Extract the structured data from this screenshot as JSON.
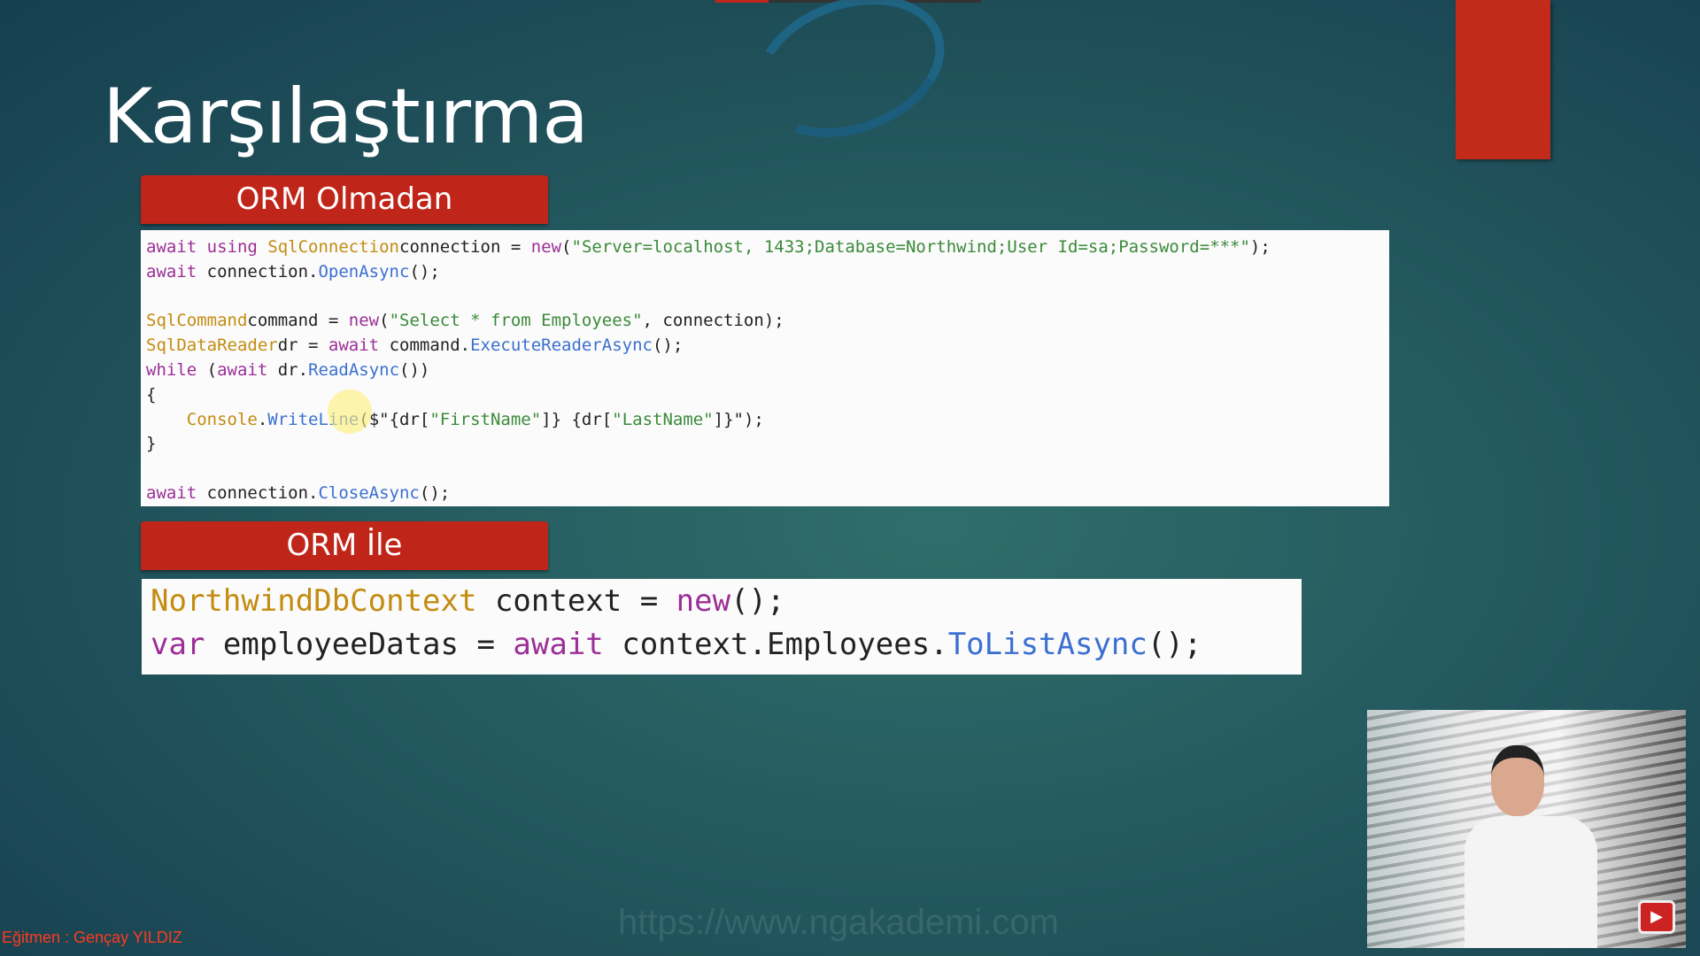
{
  "slide": {
    "title": "Karşılaştırma",
    "section1": "ORM Olmadan",
    "section2": "ORM İle"
  },
  "code1": [
    [
      [
        "kw",
        "await using "
      ],
      [
        "ty",
        "SqlConnection"
      ],
      [
        "",
        "connection = "
      ],
      [
        "kw",
        "new"
      ],
      [
        "",
        "("
      ],
      [
        "st",
        "\"Server=localhost, 1433;Database=Northwind;User Id=sa;Password=***\""
      ],
      [
        "",
        ");"
      ]
    ],
    [
      [
        "kw",
        "await "
      ],
      [
        "",
        "connection."
      ],
      [
        "mt",
        "OpenAsync"
      ],
      [
        "",
        "();"
      ]
    ],
    [],
    [
      [
        "ty",
        "SqlCommand"
      ],
      [
        "",
        "command = "
      ],
      [
        "kw",
        "new"
      ],
      [
        "",
        "("
      ],
      [
        "st",
        "\"Select * from Employees\""
      ],
      [
        "",
        ", connection);"
      ]
    ],
    [
      [
        "ty",
        "SqlDataReader"
      ],
      [
        "",
        "dr = "
      ],
      [
        "kw",
        "await "
      ],
      [
        "",
        "command."
      ],
      [
        "mt",
        "ExecuteReaderAsync"
      ],
      [
        "",
        "();"
      ]
    ],
    [
      [
        "kw",
        "while "
      ],
      [
        "",
        "("
      ],
      [
        "kw",
        "await "
      ],
      [
        "",
        "dr."
      ],
      [
        "mt",
        "ReadAsync"
      ],
      [
        "",
        "())"
      ]
    ],
    [
      [
        "",
        "{"
      ]
    ],
    [
      [
        "",
        "    "
      ],
      [
        "ty",
        "Console"
      ],
      [
        "",
        "."
      ],
      [
        "mt",
        "WriteLine"
      ],
      [
        "",
        "($\"{dr["
      ],
      [
        "st",
        "\"FirstName\""
      ],
      [
        "",
        "]} {dr["
      ],
      [
        "st",
        "\"LastName\""
      ],
      [
        "",
        "]}\");"
      ]
    ],
    [
      [
        "",
        "}"
      ]
    ],
    [],
    [
      [
        "kw",
        "await "
      ],
      [
        "",
        "connection."
      ],
      [
        "mt",
        "CloseAsync"
      ],
      [
        "",
        "();"
      ]
    ]
  ],
  "code2": [
    [
      [
        "ty",
        "NorthwindDbContext"
      ],
      [
        "",
        " context = "
      ],
      [
        "kw",
        "new"
      ],
      [
        "",
        "();"
      ]
    ],
    [
      [
        "kw",
        "var "
      ],
      [
        "",
        "employeeDatas = "
      ],
      [
        "kw",
        "await "
      ],
      [
        "",
        "context.Employees."
      ],
      [
        "mt",
        "ToListAsync"
      ],
      [
        "",
        "();"
      ]
    ]
  ],
  "footer": {
    "trainer": "Eğitmen : Gençay YILDIZ",
    "watermark": "https://www.ngakademi.com"
  },
  "colors": {
    "banner": "#c02519",
    "keyword": "#9b2f96",
    "type": "#c38c10",
    "method": "#3b6fd0",
    "string": "#3a8a3a"
  },
  "icons": {
    "webcam_badge": "youtube-play-icon"
  }
}
